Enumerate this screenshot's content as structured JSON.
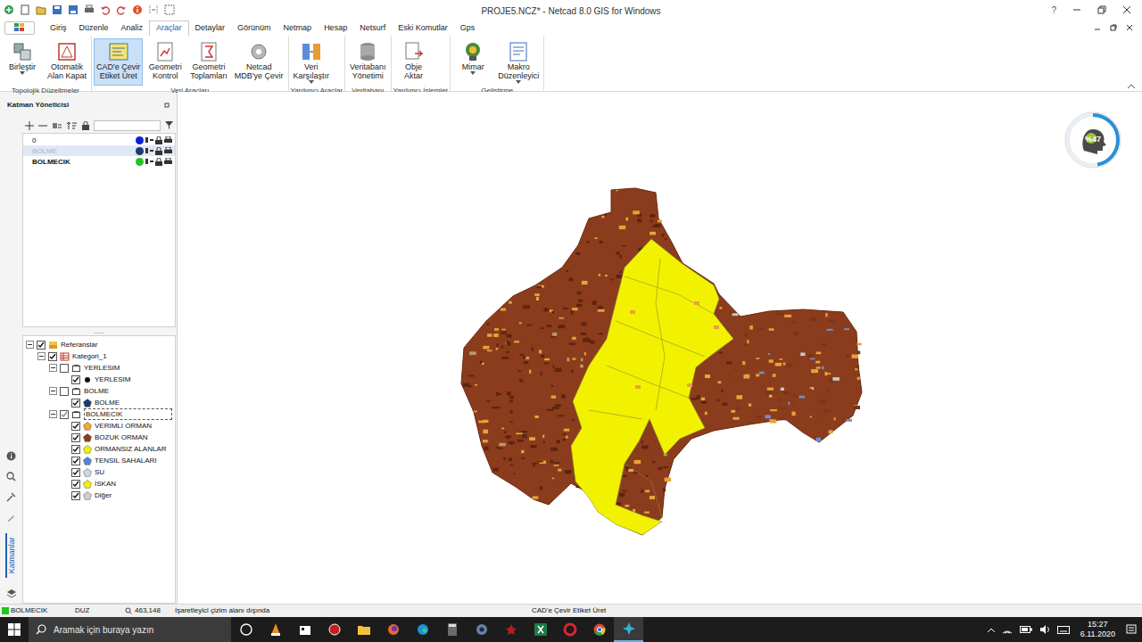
{
  "window": {
    "title": "PROJE5.NCZ* - Netcad 8.0 GIS for Windows",
    "help": "?"
  },
  "tabs": [
    {
      "label": "Giriş",
      "selected": false
    },
    {
      "label": "Düzenle",
      "selected": false
    },
    {
      "label": "Analiz",
      "selected": false
    },
    {
      "label": "Araçlar",
      "selected": true
    },
    {
      "label": "Detaylar",
      "selected": false
    },
    {
      "label": "Görünüm",
      "selected": false
    },
    {
      "label": "Netmap",
      "selected": false
    },
    {
      "label": "Hesap",
      "selected": false
    },
    {
      "label": "Netsurf",
      "selected": false
    },
    {
      "label": "Eski Komutlar",
      "selected": false
    },
    {
      "label": "Gps",
      "selected": false
    }
  ],
  "ribbon": {
    "groups": [
      {
        "label": "Topolojik Düzeltmeler",
        "buttons": [
          {
            "lines": [
              "Birleştir"
            ],
            "selected": false,
            "dropdown": true
          },
          {
            "lines": [
              "Otomatik",
              "Alan Kapat"
            ],
            "selected": false,
            "dropdown": false
          }
        ]
      },
      {
        "label": "Veri Araçları",
        "buttons": [
          {
            "lines": [
              "CAD'e Çevir",
              "Etiket Üret"
            ],
            "selected": true,
            "dropdown": false
          },
          {
            "lines": [
              "Geometri",
              "Kontrol"
            ],
            "selected": false,
            "dropdown": false
          },
          {
            "lines": [
              "Geometri",
              "Toplamları"
            ],
            "selected": false,
            "dropdown": false
          },
          {
            "lines": [
              "Netcad",
              "MDB'ye Çevir"
            ],
            "selected": false,
            "dropdown": false
          }
        ]
      },
      {
        "label": "Yardımcı Araçlar",
        "buttons": [
          {
            "lines": [
              "Veri",
              "Karşılaştır"
            ],
            "selected": false,
            "dropdown": true
          }
        ]
      },
      {
        "label": "Veritabanı",
        "buttons": [
          {
            "lines": [
              "Veritabanı",
              "Yönetimi"
            ],
            "selected": false,
            "dropdown": false
          }
        ]
      },
      {
        "label": "Yardımcı İşlemler",
        "buttons": [
          {
            "lines": [
              "Obje",
              "Aktar"
            ],
            "selected": false,
            "dropdown": false
          }
        ]
      },
      {
        "label": "Geliştirme",
        "buttons": [
          {
            "lines": [
              "Mimar"
            ],
            "selected": false,
            "dropdown": true
          },
          {
            "lines": [
              "Makro",
              "Düzenleyici"
            ],
            "selected": false,
            "dropdown": true
          }
        ]
      }
    ]
  },
  "layer_manager": {
    "title": "Katman Yöneticisi",
    "search": {
      "value": ""
    },
    "layers": [
      {
        "name": "0",
        "color": "#0a1fd6",
        "selected": false,
        "current": false
      },
      {
        "name": "BOLME",
        "color": "#1e3a6e",
        "selected": true,
        "current": false
      },
      {
        "name": "BOLMECIK",
        "color": "#22c51e",
        "selected": false,
        "current": true
      }
    ],
    "splitter": ".....",
    "tree": [
      {
        "label": "Referanslar",
        "kind": "group",
        "level": 0,
        "checked": true,
        "expanded": true,
        "selected": false
      },
      {
        "label": "Kategori_1",
        "kind": "category",
        "level": 1,
        "checked": true,
        "expanded": true,
        "selected": false
      },
      {
        "label": "YERLESIM",
        "kind": "folder",
        "level": 2,
        "checked": false,
        "expanded": true,
        "selected": false
      },
      {
        "label": "YERLESIM",
        "kind": "dot",
        "level": 3,
        "checked": true,
        "selected": false,
        "color": "#111111"
      },
      {
        "label": "BOLME",
        "kind": "folder",
        "level": 2,
        "checked": false,
        "expanded": true,
        "selected": false
      },
      {
        "label": "BOLME",
        "kind": "symbol",
        "level": 3,
        "checked": true,
        "selected": false,
        "color": "#1e3a6e"
      },
      {
        "label": "BOLMECIK",
        "kind": "folder",
        "level": 2,
        "checked": true,
        "expanded": true,
        "selected": true
      },
      {
        "label": "VERIMLI ORMAN",
        "kind": "symbol",
        "level": 3,
        "checked": true,
        "selected": false,
        "color": "#f0a830"
      },
      {
        "label": "BOZUK ORMAN",
        "kind": "symbol",
        "level": 3,
        "checked": true,
        "selected": false,
        "color": "#8b3c1c"
      },
      {
        "label": "ORMANSIZ ALANLAR",
        "kind": "symbol",
        "level": 3,
        "checked": true,
        "selected": false,
        "color": "#f2f200"
      },
      {
        "label": "TENSIL SAHALARI",
        "kind": "symbol",
        "level": 3,
        "checked": true,
        "selected": false,
        "color": "#4f86d8"
      },
      {
        "label": "SU",
        "kind": "symbol",
        "level": 3,
        "checked": true,
        "selected": false,
        "color": "#c8d6ee"
      },
      {
        "label": "İSKAN",
        "kind": "symbol",
        "level": 3,
        "checked": true,
        "selected": false,
        "color": "#f5f000"
      },
      {
        "label": "Diğer",
        "kind": "symbol",
        "level": 3,
        "checked": true,
        "selected": false,
        "color": "#cfcfcf"
      }
    ]
  },
  "side_strip": {
    "label": "Katmanlar"
  },
  "progress": {
    "label": "%47",
    "level": 0.47
  },
  "status_bar": {
    "layer": "BOLMECIK",
    "layer_color": "#22c51e",
    "mode": "DUZ",
    "coords": "463,148",
    "message": "İşaretleyici çizim alanı dışında",
    "command": "CAD'e Çevir Etiket Üret"
  },
  "taskbar": {
    "search_placeholder": "Aramak için buraya yazın",
    "time": "15:27",
    "date": "6.11.2020"
  }
}
